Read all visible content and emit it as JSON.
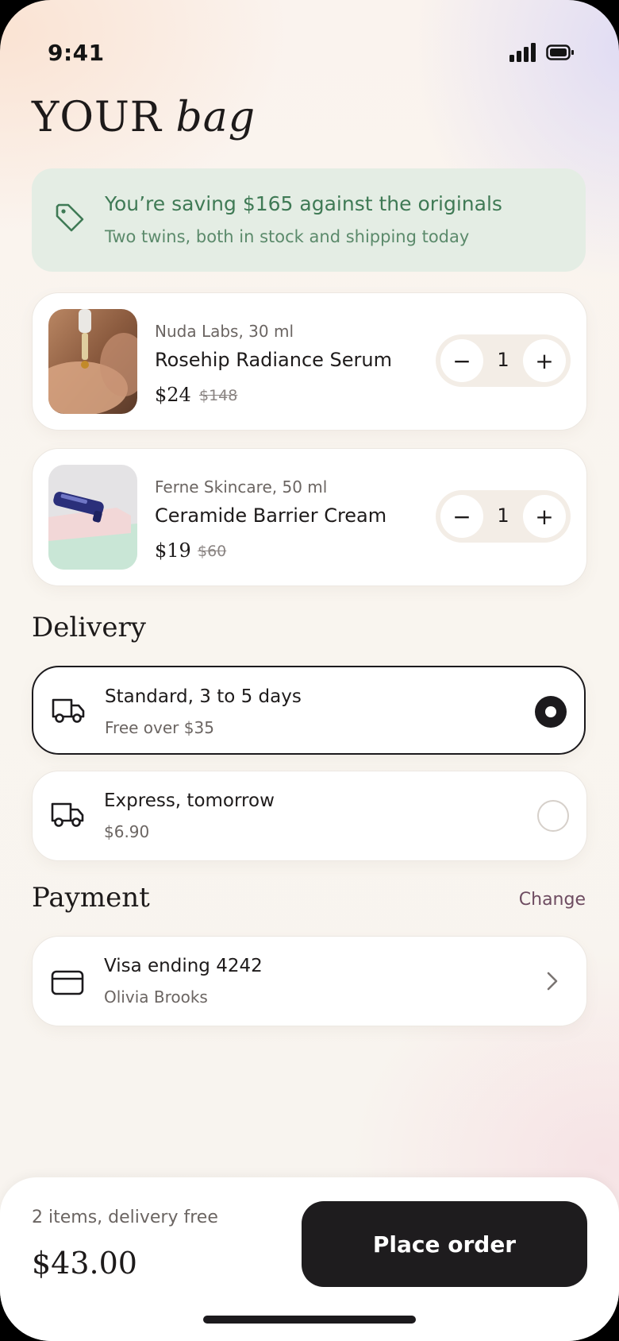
{
  "status": {
    "time": "9:41"
  },
  "title": {
    "word1": "YOUR",
    "word2": "bag"
  },
  "savings": {
    "headline": "You’re saving $165 against the originals",
    "sub": "Two twins, both in stock and shipping today",
    "accent": "#3f7a55"
  },
  "items": [
    {
      "brand": "Nuda Labs, 30 ml",
      "name": "Rosehip Radiance Serum",
      "price": "$24",
      "old_price": "$148",
      "qty": "1",
      "minus": "−",
      "plus": "+"
    },
    {
      "brand": "Ferne Skincare, 50 ml",
      "name": "Ceramide Barrier Cream",
      "price": "$19",
      "old_price": "$60",
      "qty": "1",
      "minus": "−",
      "plus": "+"
    }
  ],
  "delivery": {
    "heading": "Delivery",
    "options": [
      {
        "label": "Standard, 3 to 5 days",
        "detail": "Free over $35",
        "selected": true,
        "icon": "truck-icon"
      },
      {
        "label": "Express, tomorrow",
        "detail": "$6.90",
        "selected": false,
        "icon": "truck-icon"
      }
    ]
  },
  "payment": {
    "heading": "Payment",
    "change_label": "Change",
    "card_label": "Visa ending 4242",
    "holder": "Olivia Brooks",
    "icon": "credit-card-icon"
  },
  "footer": {
    "summary": "2 items, delivery free",
    "total": "$43.00",
    "cta": "Place order"
  }
}
